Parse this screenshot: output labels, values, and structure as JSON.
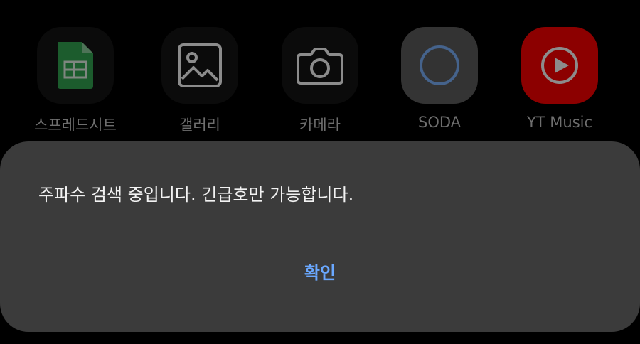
{
  "apps": [
    {
      "label": "스프레드시트",
      "icon": "sheets-icon",
      "color": "#34a853"
    },
    {
      "label": "갤러리",
      "icon": "gallery-icon",
      "color": "#ffffff"
    },
    {
      "label": "카메라",
      "icon": "camera-icon",
      "color": "#ffffff"
    },
    {
      "label": "SODA",
      "icon": "soda-icon",
      "color": "#7fb4ff"
    },
    {
      "label": "YT Music",
      "icon": "yt-music-icon",
      "color": "#ff0000"
    }
  ],
  "dialog": {
    "message": "주파수 검색 중입니다. 긴급호만 가능합니다.",
    "confirm_label": "확인",
    "accent_color": "#6aa8ff",
    "background_color": "#3b3b3b"
  }
}
